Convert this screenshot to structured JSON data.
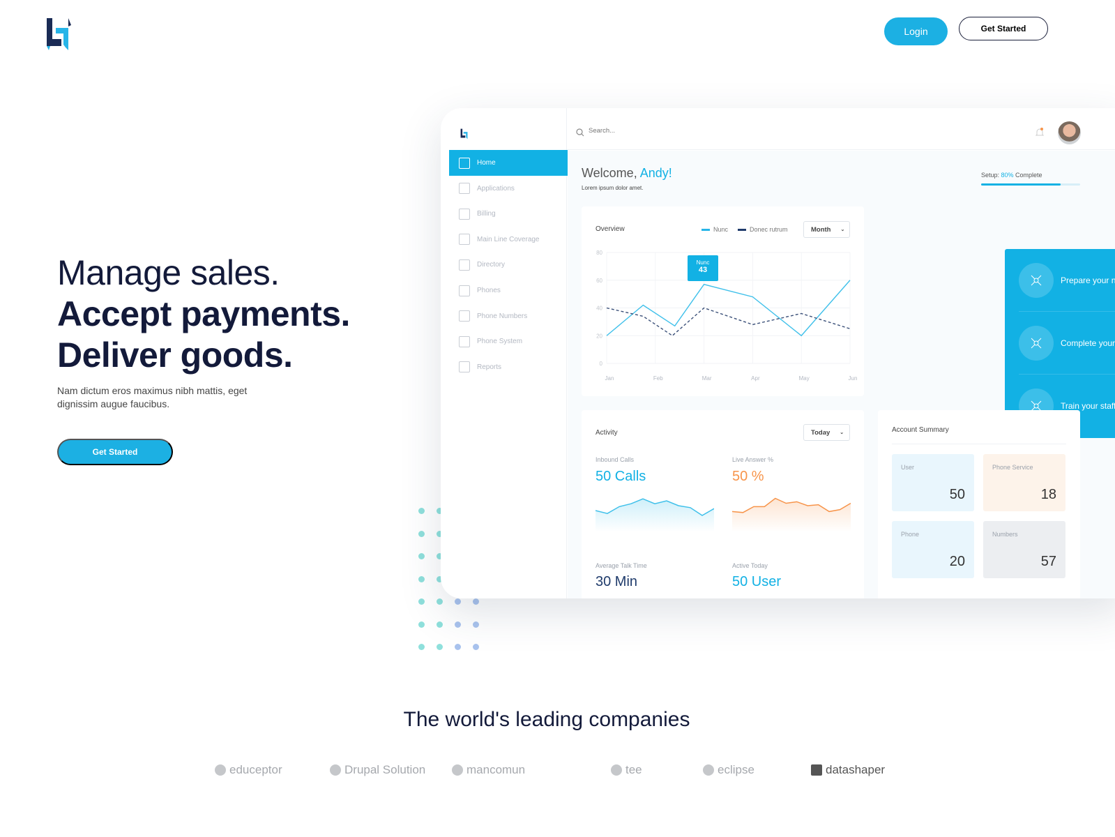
{
  "header": {
    "login": "Login",
    "get_started": "Get Started"
  },
  "hero": {
    "line1": "Manage sales.",
    "line2": "Accept payments.",
    "line3": "Deliver goods.",
    "subtitle": "Nam dictum eros maximus nibh mattis, eget dignissim augue faucibus.",
    "cta": "Get Started"
  },
  "dashboard": {
    "search_placeholder": "Search...",
    "sidebar": [
      {
        "label": "Home",
        "icon": "home-icon",
        "active": true
      },
      {
        "label": "Applications",
        "icon": "document-icon"
      },
      {
        "label": "Billing",
        "icon": "credit-card-icon"
      },
      {
        "label": "Main Line Coverage",
        "icon": "coverage-icon"
      },
      {
        "label": "Directory",
        "icon": "directory-icon"
      },
      {
        "label": "Phones",
        "icon": "phones-icon"
      },
      {
        "label": "Phone Numbers",
        "icon": "phone-number-icon"
      },
      {
        "label": "Phone System",
        "icon": "phone-system-icon"
      },
      {
        "label": "Reports",
        "icon": "reports-icon"
      }
    ],
    "welcome": "Welcome, ",
    "user": "Andy!",
    "welcome_sub": "Lorem ipsum dolor amet.",
    "setup": {
      "prefix": "Setup: ",
      "percent": "80%",
      "suffix": " Complete",
      "progress": 0.8
    },
    "overview": {
      "title": "Overview",
      "period": "Month",
      "tooltip_series": "Nunc",
      "tooltip_value": "43"
    },
    "tasks": [
      {
        "label": "Prepare your network",
        "icon": "network-icon"
      },
      {
        "label": "Complete your number transfer",
        "icon": "transfer-icon"
      },
      {
        "label": "Train your staff",
        "icon": "presentation-icon"
      }
    ],
    "activity": {
      "title": "Activity",
      "period": "Today",
      "inbound_label": "Inbound Calls",
      "inbound_value": "50 Calls",
      "live_label": "Live Answer %",
      "live_value": "50 %",
      "talk_label": "Average Talk Time",
      "talk_value": "30 Min",
      "active_label": "Active Today",
      "active_value": "50 User",
      "inbound_spark": [
        30,
        24,
        38,
        44,
        54,
        44,
        50,
        40,
        36,
        20,
        34
      ],
      "live_spark": [
        28,
        26,
        38,
        38,
        55,
        45,
        48,
        40,
        42,
        28,
        32,
        45
      ]
    },
    "summary": {
      "title": "Account Summary",
      "tiles": [
        {
          "label": "User",
          "value": "50"
        },
        {
          "label": "Phone Service",
          "value": "18"
        },
        {
          "label": "Phone",
          "value": "20"
        },
        {
          "label": "Numbers",
          "value": "57"
        }
      ]
    },
    "colors": {
      "accent": "#12b1e4",
      "orange": "#f7944a",
      "navy": "#1f3b6b"
    }
  },
  "chart_data": {
    "type": "line",
    "categories": [
      "Jan",
      "Feb",
      "Mar",
      "Apr",
      "May",
      "Jun"
    ],
    "ylim": [
      0,
      80
    ],
    "yticks": [
      0,
      20,
      40,
      60,
      80
    ],
    "grid": true,
    "legend": "top-right",
    "series": [
      {
        "name": "Nunc",
        "points": [
          [
            0,
            20
          ],
          [
            0.75,
            42
          ],
          [
            1.4,
            27
          ],
          [
            2,
            57
          ],
          [
            3,
            48
          ],
          [
            4,
            20
          ],
          [
            5,
            60
          ]
        ]
      },
      {
        "name": "Donec rutrum",
        "style": "dashed",
        "points": [
          [
            0,
            40
          ],
          [
            0.75,
            34
          ],
          [
            1.35,
            20
          ],
          [
            2,
            40
          ],
          [
            3,
            28
          ],
          [
            4,
            36
          ],
          [
            5,
            25
          ]
        ]
      }
    ]
  },
  "partners": {
    "title": "The world's leading companies",
    "logos": [
      "educeptor",
      "Drupal Solution",
      "mancomun",
      "tee",
      "eclipse",
      "datashaper"
    ]
  }
}
